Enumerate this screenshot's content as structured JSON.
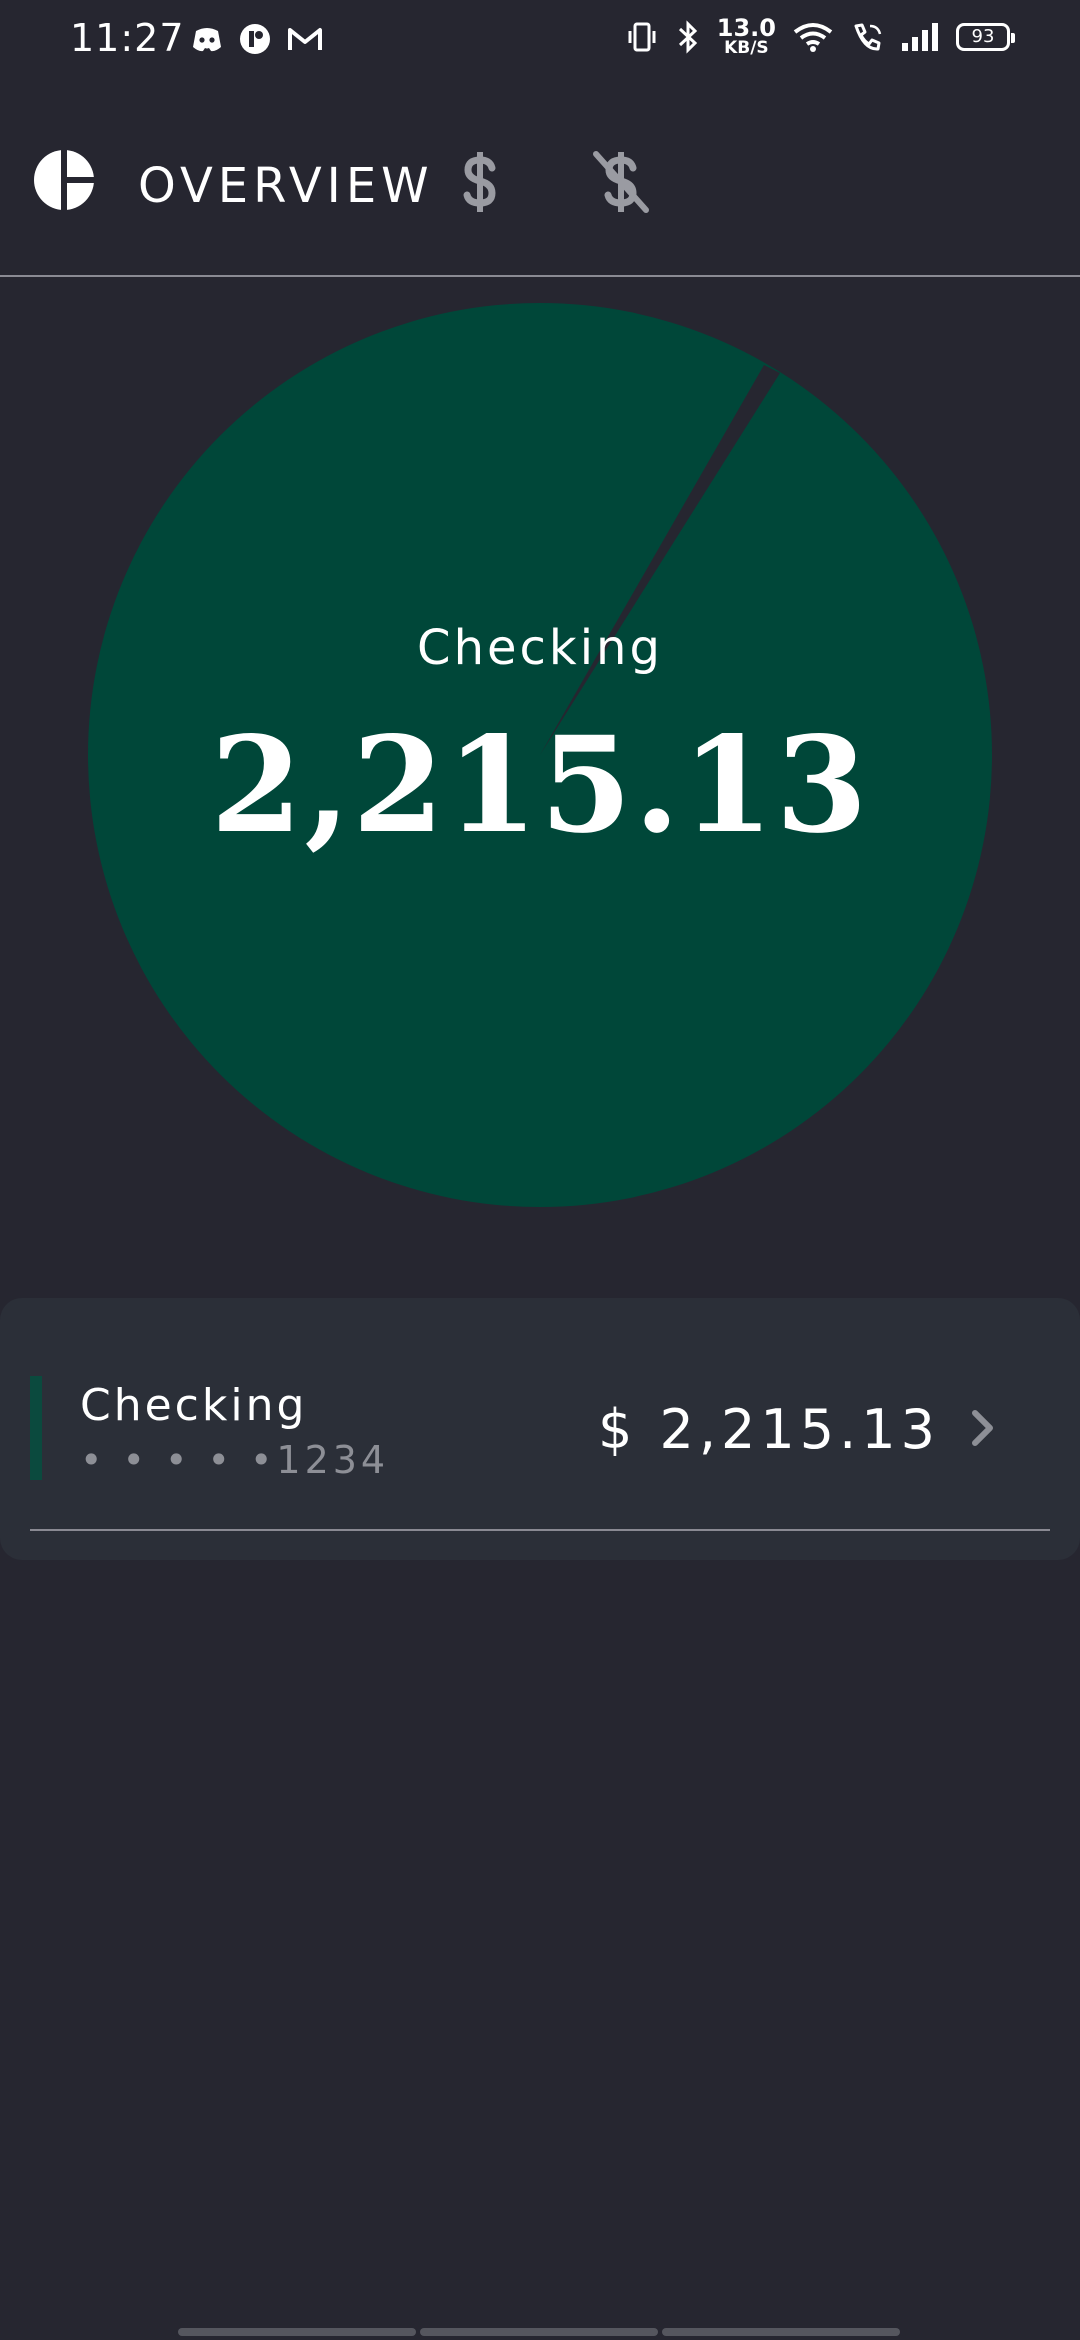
{
  "status_bar": {
    "time": "11:27",
    "net_speed_value": "13.0",
    "net_speed_unit": "KB/S",
    "battery": "93",
    "left_icons": [
      "discord-icon",
      "app-icon",
      "gmail-icon"
    ],
    "right_icons": [
      "vibrate-icon",
      "bluetooth-icon",
      "wifi-icon",
      "wifi-call-icon",
      "signal-icon",
      "battery-icon"
    ]
  },
  "nav": {
    "logo_icon": "pie-logo-icon",
    "tabs": [
      {
        "label": "OVERVIEW",
        "active": true
      },
      {
        "icon": "dollar-icon",
        "active": false
      },
      {
        "icon": "no-dollar-icon",
        "active": false
      }
    ]
  },
  "chart_data": {
    "type": "pie",
    "center_label": "Checking",
    "center_value": "2,215.13",
    "slices": [
      {
        "name": "Checking",
        "value": 2215.13,
        "color": "#004739"
      }
    ]
  },
  "accounts": [
    {
      "name": "Checking",
      "masked_number": "• • • • •1234",
      "currency": "$",
      "balance": "2,215.13",
      "color": "#0b4a3e"
    }
  ],
  "colors": {
    "background": "#262630",
    "card": "#2b2f38",
    "pie": "#004739",
    "muted": "#8d8f96"
  }
}
